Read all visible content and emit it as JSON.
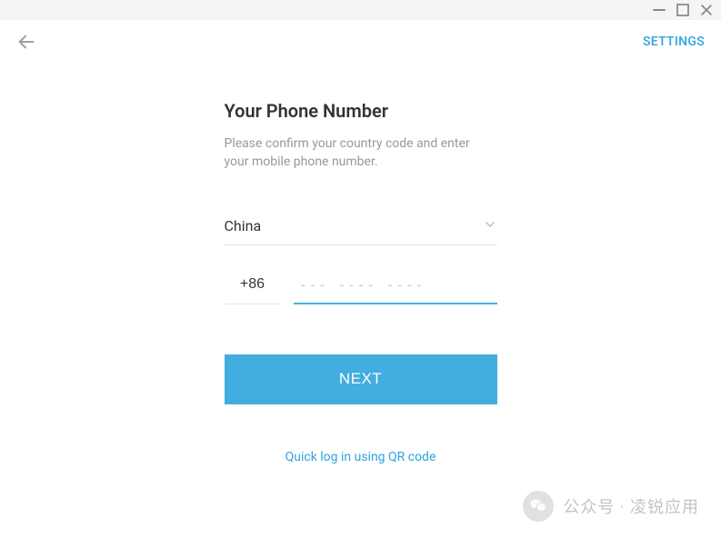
{
  "window": {
    "minimize": "—",
    "maximize": "☐",
    "close": "✕"
  },
  "header": {
    "settings_label": "SETTINGS"
  },
  "main": {
    "title": "Your Phone Number",
    "description": "Please confirm your country code and enter your mobile phone number.",
    "country": {
      "selected": "China"
    },
    "phone": {
      "code": "+86",
      "placeholder": "--- ---- ----",
      "value": ""
    },
    "next_label": "NEXT",
    "qr_link_label": "Quick log in using QR code"
  },
  "watermark": {
    "text": "公众号 · 凌锐应用"
  }
}
